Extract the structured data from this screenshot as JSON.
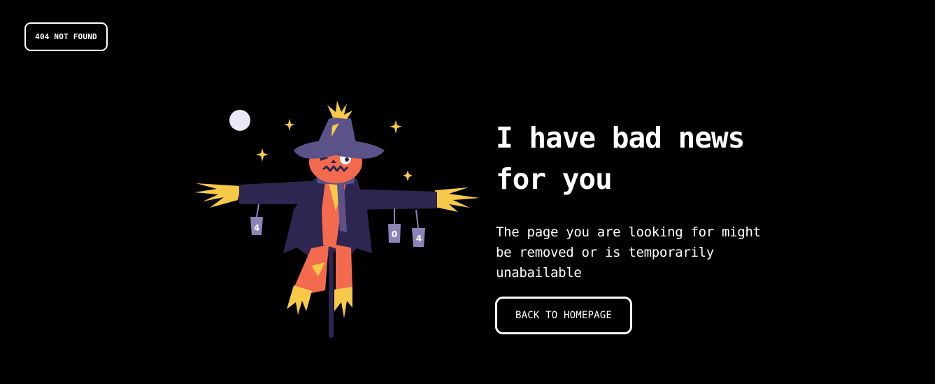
{
  "badge": {
    "label": "404 NOT FOUND"
  },
  "hero": {
    "headline": "I have bad news for you",
    "message": "The page you are looking for might be removed or is temporarily unabailable",
    "button_label": "BACK TO HOMEPAGE"
  },
  "illustration": {
    "can_labels": [
      "4",
      "0",
      "4"
    ],
    "colors": {
      "background": "#000000",
      "hat": "#5a5289",
      "coat": "#2c2650",
      "pumpkin": "#f46a4e",
      "straw": "#f7c948",
      "moon": "#e8e9f5",
      "can": "#8a84b8"
    }
  }
}
